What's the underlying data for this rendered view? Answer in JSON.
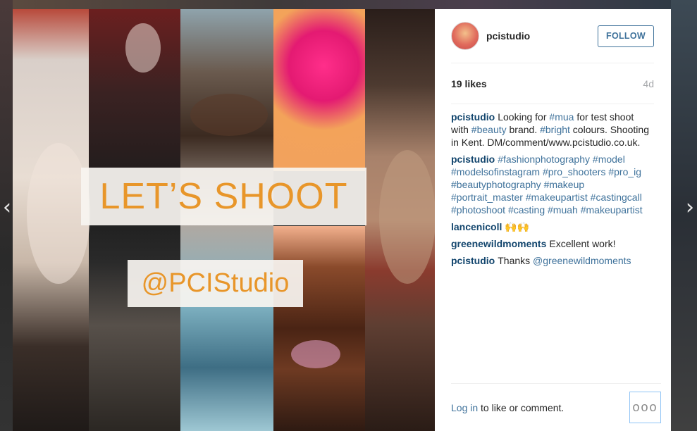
{
  "navigation": {
    "prev_glyph": "‹",
    "next_glyph": "›"
  },
  "photo": {
    "headline": "LET’S SHOOT",
    "handle": "@PCIStudio",
    "accent_color": "#e8962a"
  },
  "post": {
    "username": "pcistudio",
    "follow_label": "FOLLOW",
    "likes": "19 likes",
    "age": "4d"
  },
  "comments": [
    {
      "user": "pcistudio",
      "parts": [
        {
          "t": "Looking for ",
          "tag": false
        },
        {
          "t": "#mua",
          "tag": true
        },
        {
          "t": " for test shoot with ",
          "tag": false
        },
        {
          "t": "#beauty",
          "tag": true
        },
        {
          "t": " brand. ",
          "tag": false
        },
        {
          "t": "#bright",
          "tag": true
        },
        {
          "t": " colours. Shooting in Kent. DM/comment/www.pcistudio.co.uk.",
          "tag": false
        }
      ]
    },
    {
      "user": "pcistudio",
      "parts": [
        {
          "t": "#fashionphotography",
          "tag": true
        },
        {
          "t": " ",
          "tag": false
        },
        {
          "t": "#model",
          "tag": true
        },
        {
          "t": " ",
          "tag": false
        },
        {
          "t": "#modelsofinstagram",
          "tag": true
        },
        {
          "t": " ",
          "tag": false
        },
        {
          "t": "#pro_shooters",
          "tag": true
        },
        {
          "t": " ",
          "tag": false
        },
        {
          "t": "#pro_ig",
          "tag": true
        },
        {
          "t": " ",
          "tag": false
        },
        {
          "t": "#beautyphotography",
          "tag": true
        },
        {
          "t": " ",
          "tag": false
        },
        {
          "t": "#makeup",
          "tag": true
        },
        {
          "t": " ",
          "tag": false
        },
        {
          "t": "#portrait_master",
          "tag": true
        },
        {
          "t": " ",
          "tag": false
        },
        {
          "t": "#makeupartist",
          "tag": true
        },
        {
          "t": " ",
          "tag": false
        },
        {
          "t": "#castingcall",
          "tag": true
        },
        {
          "t": " ",
          "tag": false
        },
        {
          "t": "#photoshoot",
          "tag": true
        },
        {
          "t": " ",
          "tag": false
        },
        {
          "t": "#casting",
          "tag": true
        },
        {
          "t": " ",
          "tag": false
        },
        {
          "t": "#muah",
          "tag": true
        },
        {
          "t": " ",
          "tag": false
        },
        {
          "t": "#makeupartist",
          "tag": true
        }
      ]
    },
    {
      "user": "lancenicoll",
      "parts": [
        {
          "t": "🙌🙌",
          "tag": false
        }
      ]
    },
    {
      "user": "greenewildmoments",
      "parts": [
        {
          "t": "Excellent work!",
          "tag": false
        }
      ]
    },
    {
      "user": "pcistudio",
      "parts": [
        {
          "t": "Thanks ",
          "tag": false
        },
        {
          "t": "@greenewildmoments",
          "tag": true
        }
      ]
    }
  ],
  "footer": {
    "login_link": "Log in",
    "login_rest": " to like or comment.",
    "more_glyph": "ooo"
  },
  "colors": {
    "link_blue": "#3f729b",
    "username_blue": "#12456d",
    "muted": "#a5a7aa"
  }
}
